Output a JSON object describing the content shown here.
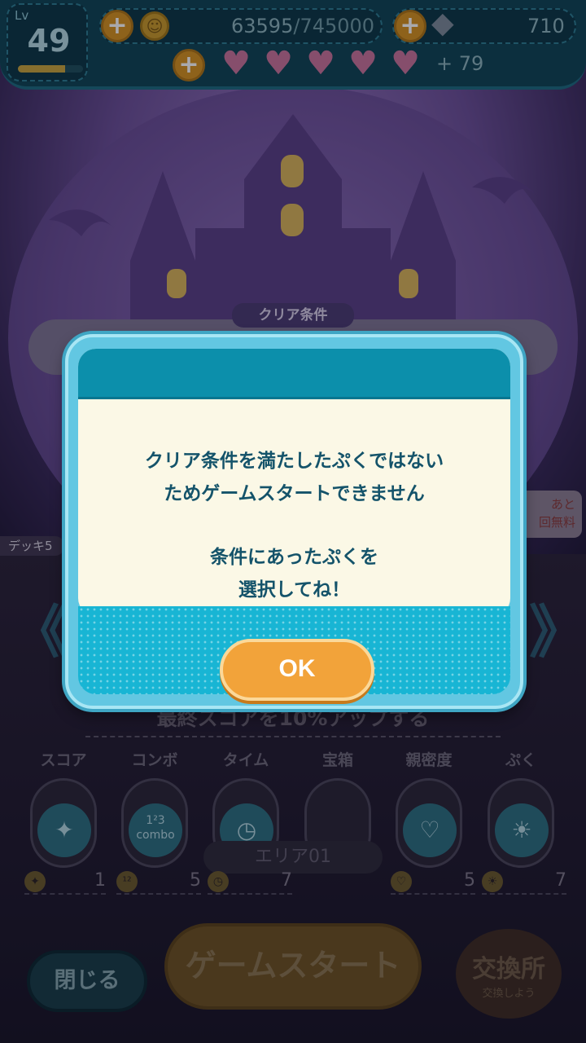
{
  "hud": {
    "level_label": "Lv",
    "level": "49",
    "level_progress": 0.72,
    "coins_current": "63595",
    "coins_max": "/745000",
    "gems": "710",
    "hearts_extra": "+ 79",
    "plus_symbol": "+"
  },
  "stage": {
    "clear_condition_title": "クリア条件",
    "deck_tag": "デッキ5",
    "free_badge_line1": "あと",
    "free_badge_line2": "回無料"
  },
  "skills": {
    "final_score_text": "最終スコアを10%アップする",
    "categories": [
      {
        "label": "スコア",
        "icon": "sparkle-icon"
      },
      {
        "label": "コンボ",
        "icon": "combo-icon"
      },
      {
        "label": "タイム",
        "icon": "clock-icon"
      },
      {
        "label": "宝箱",
        "icon": "chest-icon"
      },
      {
        "label": "親密度",
        "icon": "heart-hand-icon"
      },
      {
        "label": "ぷく",
        "icon": "bulb-icon"
      }
    ],
    "combo_icon_text": "123\ncombo",
    "area_label": "エリア01",
    "stats": [
      {
        "value": "1"
      },
      {
        "value": "5"
      },
      {
        "value": "7"
      },
      {
        "value": "5"
      },
      {
        "value": "7"
      }
    ]
  },
  "bottom": {
    "close_label": "閉じる",
    "start_label": "ゲームスタート",
    "exchange_label": "交換所",
    "exchange_sub": "交換しよう"
  },
  "dialog": {
    "line1": "クリア条件を満たしたぷくではない",
    "line2": "ためゲームスタートできません",
    "line3": "条件にあったぷくを",
    "line4": "選択してね！",
    "ok_label": "OK"
  }
}
